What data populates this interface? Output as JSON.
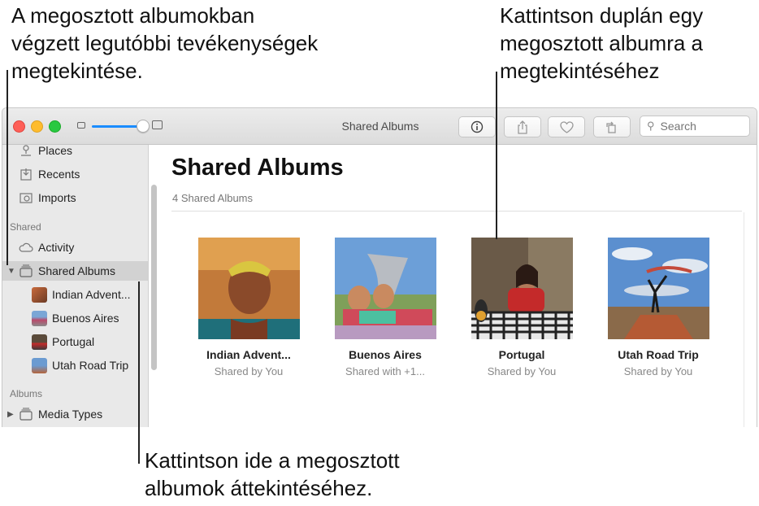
{
  "callouts": {
    "top_left": "A megosztott albumokban\nvégzett legutóbbi tevékenységek\nmegtekintése.",
    "top_right": "Kattintson duplán egy\nmegosztott albumra a\nmegtekintéséhez",
    "bottom": "Kattintson ide a megosztott\nalbumok áttekintéséhez."
  },
  "window": {
    "title": "Shared Albums",
    "search_placeholder": "Search"
  },
  "toolbar": {
    "info_icon": "info-icon",
    "share_icon": "share-icon",
    "favorite_icon": "heart-icon",
    "rotate_icon": "rotate-icon"
  },
  "sidebar": {
    "items_top": [
      {
        "label": "Places",
        "icon": "places-icon"
      },
      {
        "label": "Recents",
        "icon": "recents-icon"
      },
      {
        "label": "Imports",
        "icon": "imports-icon"
      }
    ],
    "section_shared": "Shared",
    "activity": "Activity",
    "shared_albums": "Shared Albums",
    "albums": [
      {
        "label": "Indian Advent..."
      },
      {
        "label": "Buenos Aires"
      },
      {
        "label": "Portugal"
      },
      {
        "label": "Utah Road Trip"
      }
    ],
    "section_albums": "Albums",
    "media_types": "Media Types"
  },
  "main": {
    "title": "Shared Albums",
    "subtitle": "4 Shared Albums",
    "albums": [
      {
        "name": "Indian Advent...",
        "by": "Shared by You"
      },
      {
        "name": "Buenos Aires",
        "by": "Shared with +1..."
      },
      {
        "name": "Portugal",
        "by": "Shared by You"
      },
      {
        "name": "Utah Road Trip",
        "by": "Shared by You"
      }
    ]
  },
  "colors": {
    "accent": "#1a8cff",
    "close": "#fe5f57",
    "minimize": "#febc2e",
    "zoom": "#28c840"
  }
}
